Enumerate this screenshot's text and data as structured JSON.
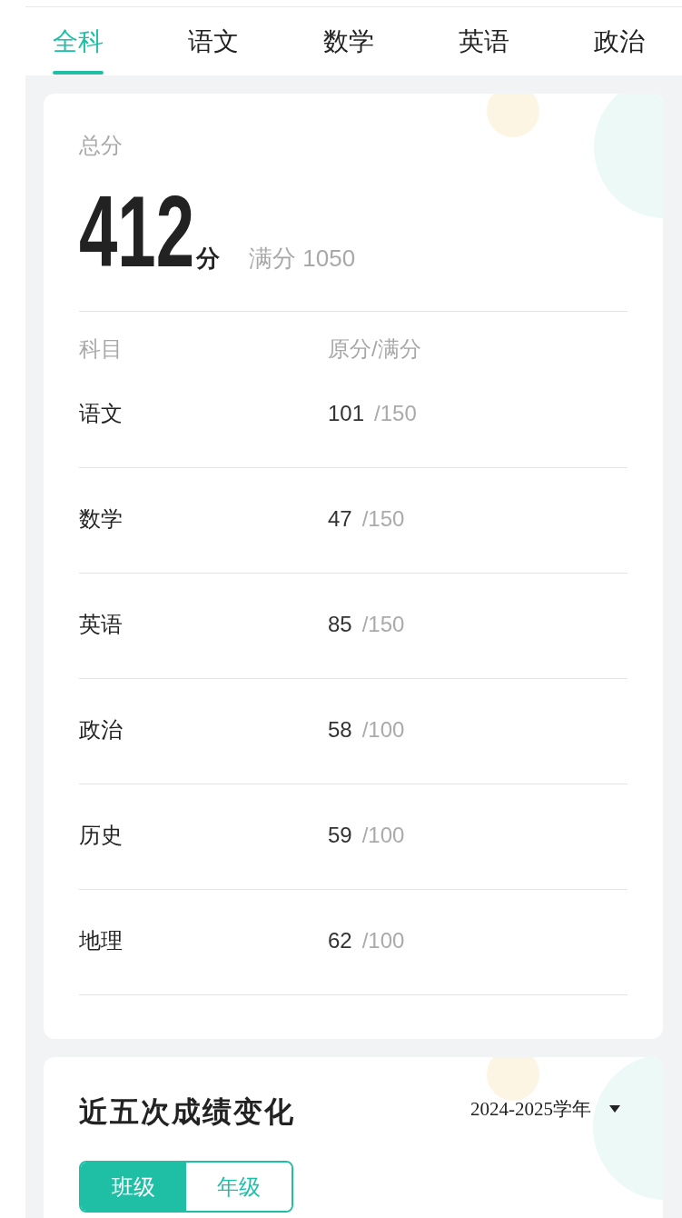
{
  "tabs": [
    {
      "label": "全科",
      "selected": true
    },
    {
      "label": "语文",
      "selected": false
    },
    {
      "label": "数学",
      "selected": false
    },
    {
      "label": "英语",
      "selected": false
    },
    {
      "label": "政治",
      "selected": false
    }
  ],
  "total": {
    "label": "总分",
    "score": "412",
    "unit": "分",
    "full_score": "满分 1050"
  },
  "table": {
    "columns": [
      "科目",
      "原分/满分"
    ],
    "rows": [
      {
        "subject": "语文",
        "score": "101",
        "full_mark": "/150"
      },
      {
        "subject": "数学",
        "score": "47",
        "full_mark": "/150"
      },
      {
        "subject": "英语",
        "score": "85",
        "full_mark": "/150"
      },
      {
        "subject": "政治",
        "score": "58",
        "full_mark": "/100"
      },
      {
        "subject": "历史",
        "score": "59",
        "full_mark": "/100"
      },
      {
        "subject": "地理",
        "score": "62",
        "full_mark": "/100"
      }
    ]
  },
  "trend": {
    "title": "近五次成绩变化",
    "year_select": "2024-2025学年",
    "segments": [
      {
        "label": "班级",
        "selected": true
      },
      {
        "label": "年级",
        "selected": false
      }
    ]
  }
}
